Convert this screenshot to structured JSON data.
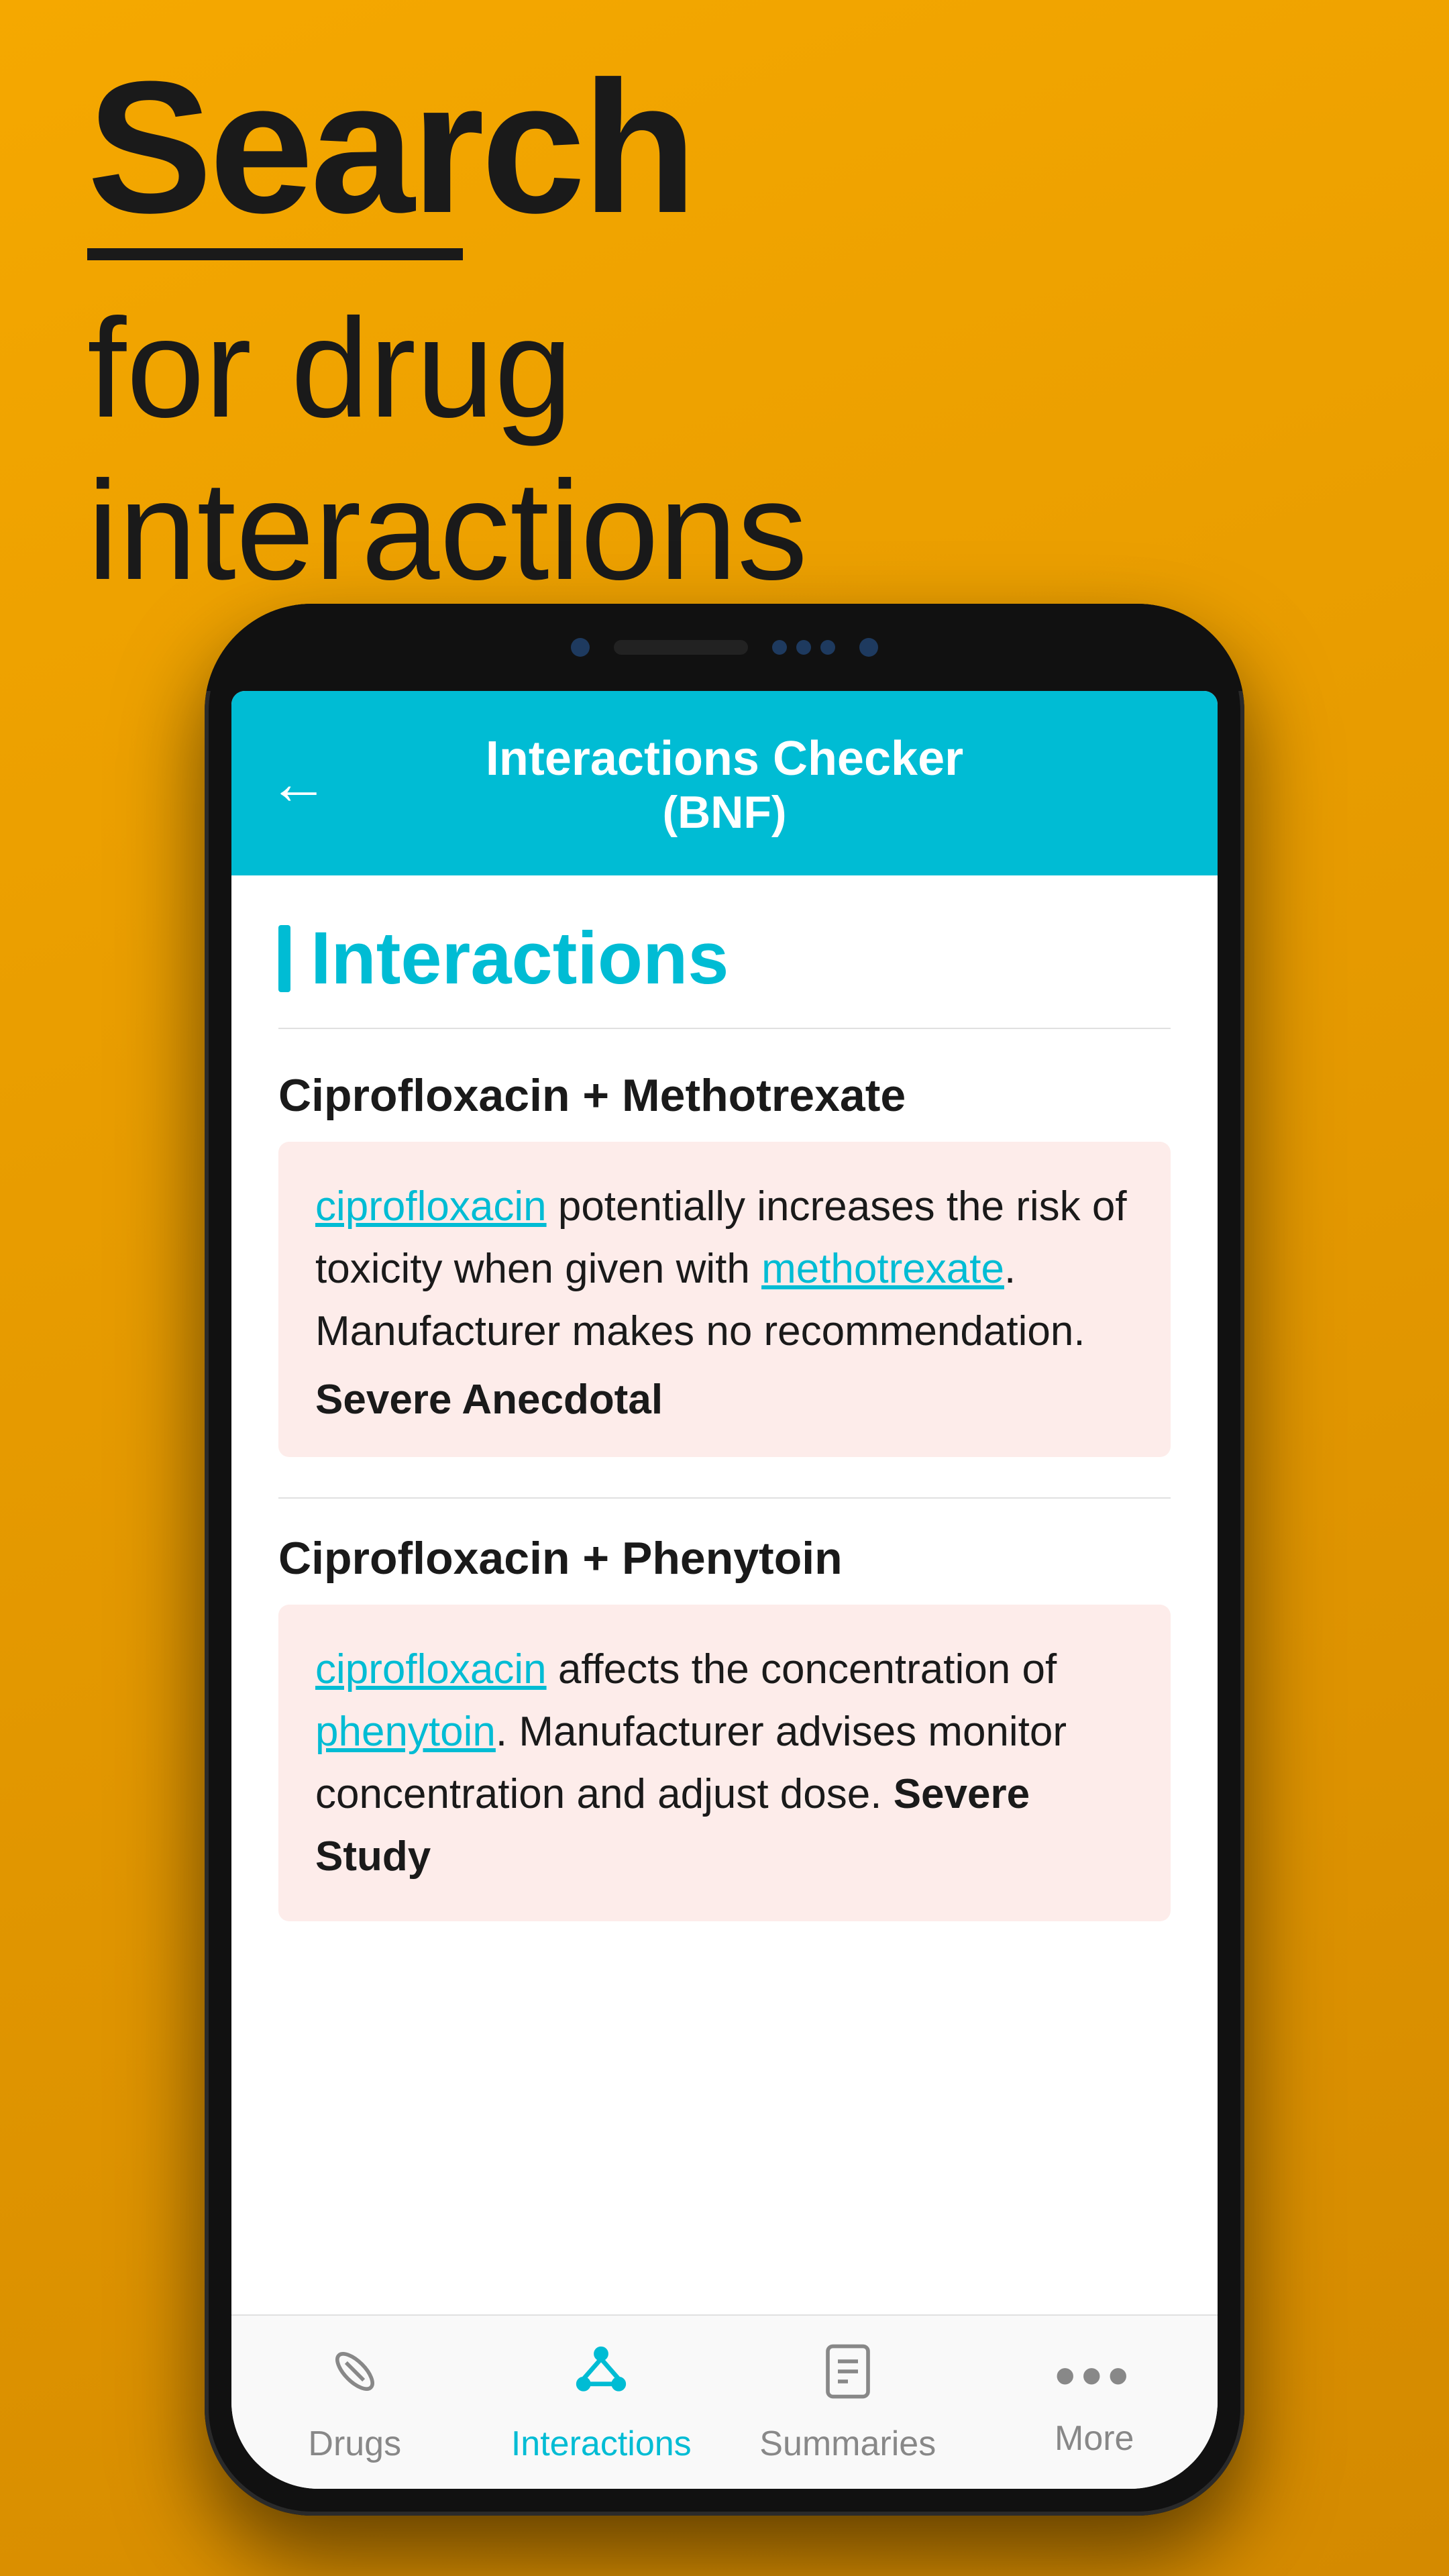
{
  "hero": {
    "search_label": "Search",
    "subtitle_line1": "for drug",
    "subtitle_line2": "interactions"
  },
  "app": {
    "header_title": "Interactions Checker",
    "header_subtitle": "(BNF)",
    "back_icon": "←"
  },
  "section": {
    "title": "Interactions"
  },
  "interactions": [
    {
      "title": "Ciprofloxacin + Methotrexate",
      "drug1": "ciprofloxacin",
      "text_before_drug1": "",
      "text_after_drug1": " potentially increases the risk of toxicity when given with ",
      "drug2": "methotrexate",
      "text_after_drug2": ". Manufacturer makes no recommendation.",
      "severity": "Severe Anecdotal"
    },
    {
      "title": "Ciprofloxacin + Phenytoin",
      "drug1": "ciprofloxacin",
      "text_before_drug1": "",
      "text_after_drug1": " affects the concentration of ",
      "drug2": "phenytoin",
      "text_after_drug2": ". Manufacturer advises monitor concentration and adjust dose.",
      "severity": "Severe Study"
    }
  ],
  "nav": {
    "items": [
      {
        "id": "drugs",
        "label": "Drugs",
        "active": false
      },
      {
        "id": "interactions",
        "label": "Interactions",
        "active": true
      },
      {
        "id": "summaries",
        "label": "Summaries",
        "active": false
      },
      {
        "id": "more",
        "label": "More",
        "active": false
      }
    ]
  }
}
